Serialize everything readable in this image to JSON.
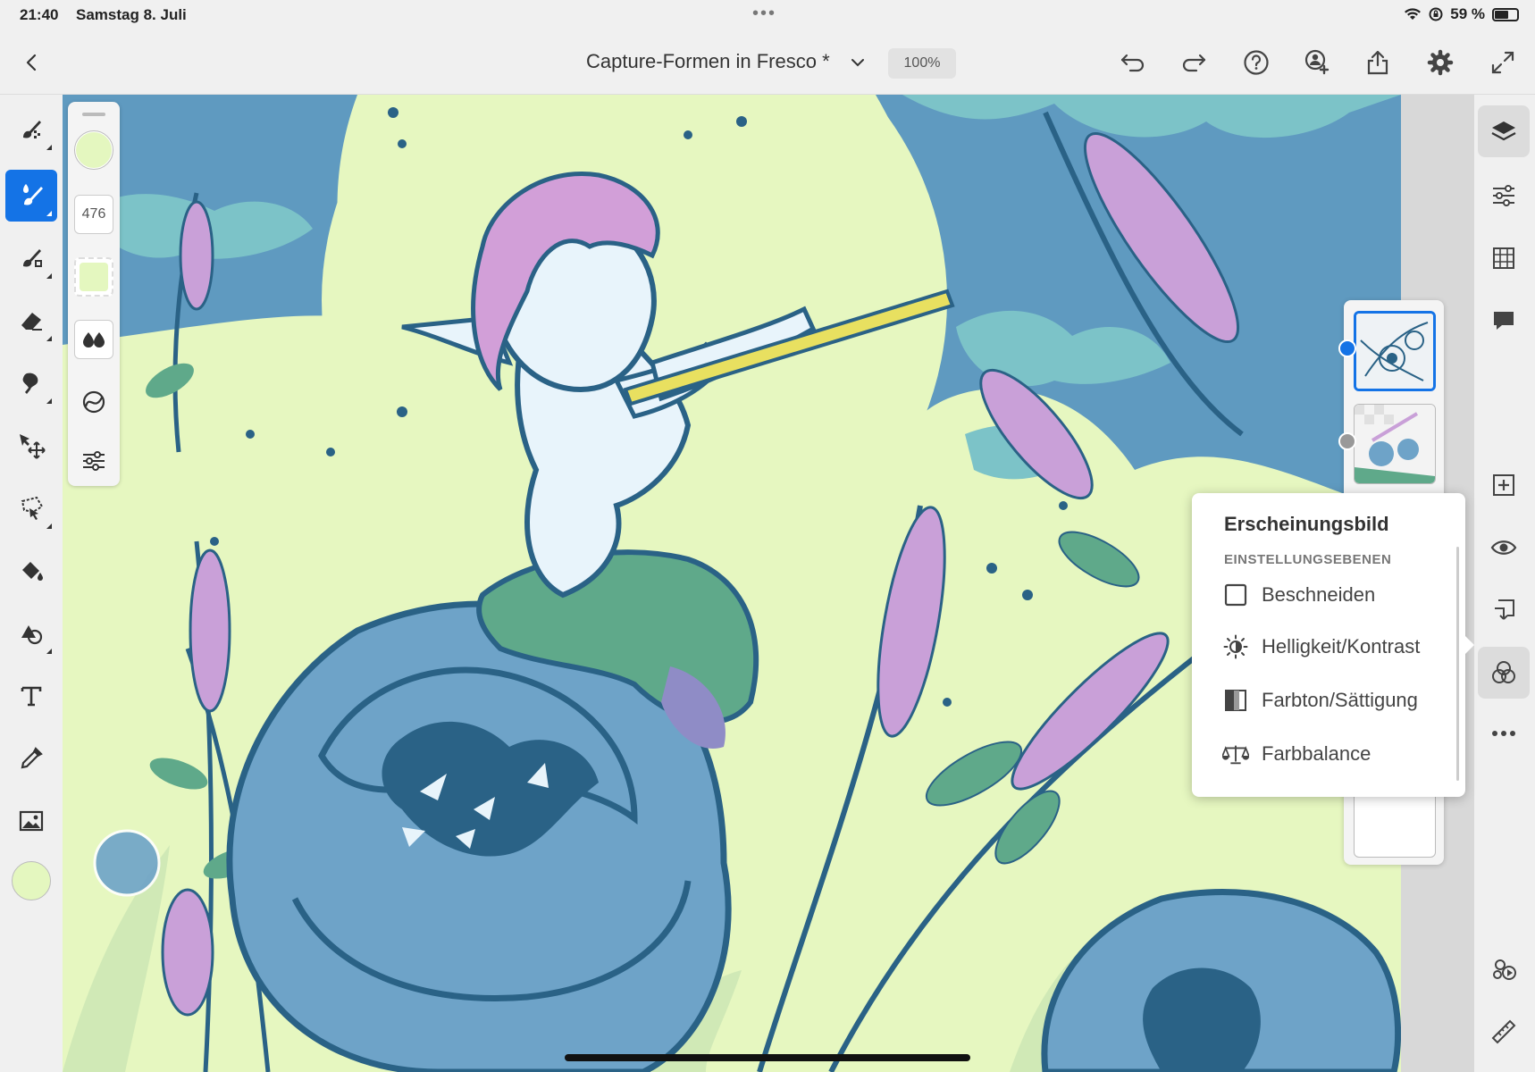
{
  "status_bar": {
    "time": "21:40",
    "date": "Samstag 8. Juli",
    "battery": "59 %",
    "battery_level": 0.59
  },
  "header": {
    "back_icon": "chevron-left-icon",
    "title": "Capture-Formen in Fresco *",
    "zoom": "100%",
    "icons": [
      "undo-icon",
      "redo-icon",
      "help-icon",
      "invite-icon",
      "share-icon",
      "settings-icon",
      "fullscreen-icon"
    ]
  },
  "left_tools": {
    "icons": [
      "pixel-brush-icon",
      "live-brush-icon",
      "vector-brush-icon",
      "eraser-icon",
      "smudge-icon",
      "move-icon",
      "lasso-icon",
      "fill-icon",
      "shapes-icon",
      "text-icon",
      "eyedropper-icon",
      "image-icon"
    ],
    "active_index": 1,
    "color": "#e4f7bf"
  },
  "brush_panel": {
    "size": "476",
    "color": "#e4f7bf"
  },
  "right_rail": {
    "icons": [
      "layers-icon",
      "layer-properties-icon",
      "grid-icon",
      "comment-icon",
      "add-layer-icon",
      "visibility-icon",
      "import-icon",
      "adjustment-icon",
      "more-icon",
      "motion-icon",
      "ruler-icon"
    ],
    "active": [
      "layers-icon",
      "adjustment-icon"
    ]
  },
  "adjust_menu": {
    "title": "Erscheinungsbild",
    "section": "EINSTELLUNGSEBENEN",
    "items": [
      {
        "label": "Beschneiden",
        "icon": "checkbox-icon"
      },
      {
        "label": "Helligkeit/Kontrast",
        "icon": "brightness-icon"
      },
      {
        "label": "Farbton/Sättigung",
        "icon": "hue-saturation-icon"
      },
      {
        "label": "Farbbalance",
        "icon": "color-balance-icon"
      }
    ]
  },
  "colors": {
    "accent": "#1473e6",
    "canvas_bg": "#e6f7c0",
    "sky": "#5f9ac0",
    "cloud": "#7cc3c8",
    "flower_blue": "#6ea3c8",
    "dark_blue": "#2a6286",
    "lavender": "#c9a0d8",
    "green": "#5fa98a",
    "skin": "#e8f4fb"
  }
}
